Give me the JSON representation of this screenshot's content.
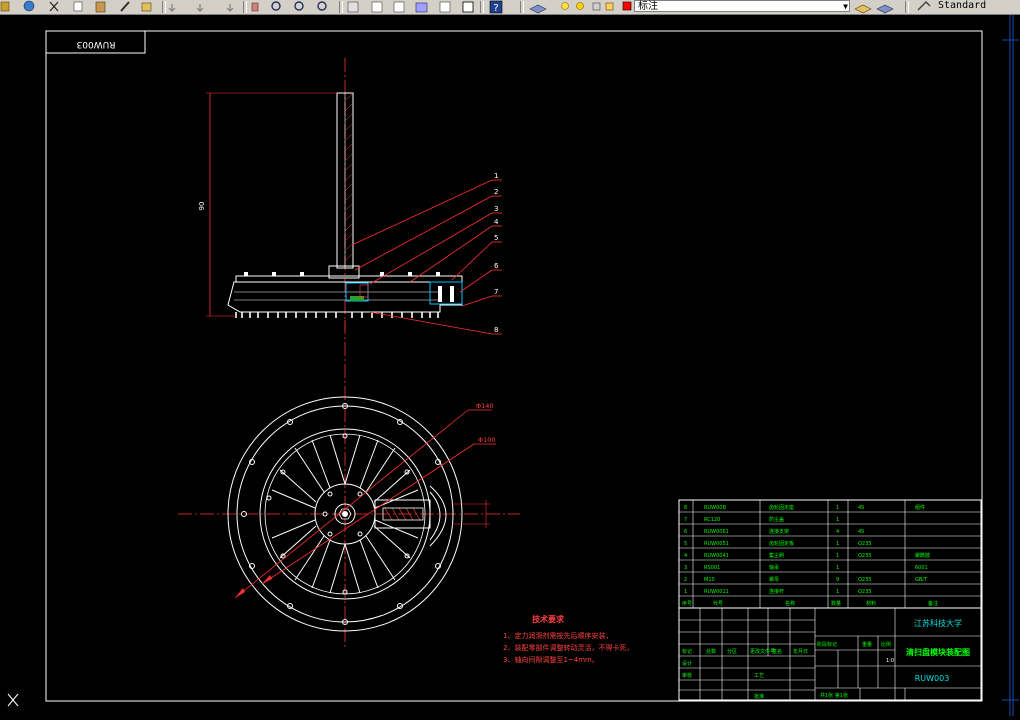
{
  "toolbar": {
    "layer_name": "标注",
    "text_style": "Standard"
  },
  "drawing": {
    "drawing_number_rotated": "RUW003",
    "dimension_height": "90",
    "dim_d1": "Φ140",
    "dim_d2": "Φ100",
    "balloons": [
      "1",
      "2",
      "3",
      "4",
      "5",
      "6",
      "7",
      "8"
    ],
    "tech_title": "技术要求",
    "tech_notes": [
      "1、定力润滑剂需按先后顺序安装，",
      "2、装配零部件调整转动灵活，不得卡死，",
      "3、轴向间隙调整至1~4mm。"
    ]
  },
  "title_block": {
    "university": "江苏科技大学",
    "drawing_title": "清扫盘模块装配图",
    "drawing_number": "RUW003",
    "scale": "1:0",
    "header_labels": [
      "标记",
      "处数",
      "分区",
      "更改文件号",
      "签名",
      "年月日"
    ],
    "left_labels": [
      "设计",
      "审核",
      "工艺",
      "批准"
    ],
    "stage_labels": [
      "阶段标记",
      "重量",
      "比例"
    ],
    "sheet_label": "共1张 第1张",
    "bom_header": [
      "序号",
      "代号",
      "名称",
      "数量",
      "材料",
      "备注"
    ],
    "bom_rows": [
      [
        "8",
        "RUW00B",
        "齿轮固定座",
        "1",
        "45",
        "组件"
      ],
      [
        "7",
        "RC120",
        "防尘盖",
        "1",
        "",
        ""
      ],
      [
        "6",
        "RUW0061",
        "连接支架",
        "4",
        "45",
        ""
      ],
      [
        "5",
        "RUW0051",
        "齿轮固定板",
        "1",
        "Q235",
        ""
      ],
      [
        "4",
        "RUW0041",
        "集尘刷",
        "1",
        "Q235",
        "聚酰胺"
      ],
      [
        "3",
        "RS001",
        "轴承",
        "1",
        "",
        "6001"
      ],
      [
        "2",
        "M10",
        "螺母",
        "9",
        "Q235",
        "GB/T"
      ],
      [
        "1",
        "RUW0011",
        "连接杆",
        "1",
        "Q235",
        ""
      ]
    ]
  }
}
